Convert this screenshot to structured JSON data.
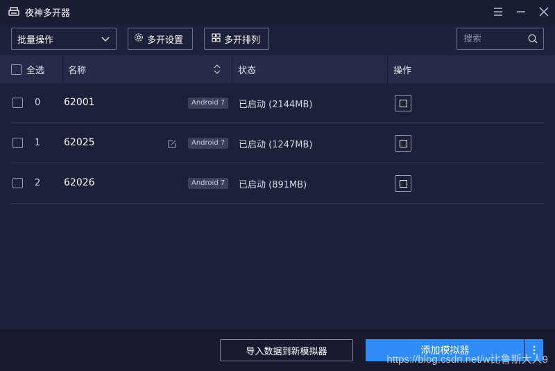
{
  "window": {
    "title": "夜神多开器",
    "app_icon": "printer-icon",
    "controls": [
      "menu-icon",
      "minimize-icon",
      "close-icon"
    ]
  },
  "toolbar": {
    "batch_select": {
      "value": "批量操作",
      "icon": "chevron-down-icon"
    },
    "settings_label": "多开设置",
    "settings_icon": "gear-icon",
    "arrange_label": "多开排列",
    "arrange_icon": "grid-icon",
    "search_placeholder": "搜索",
    "search_icon": "search-icon"
  },
  "table": {
    "headers": {
      "select_all": "全选",
      "name": "名称",
      "status": "状态",
      "actions": "操作"
    },
    "rows": [
      {
        "index": "0",
        "name": "62001",
        "badge": "Android 7",
        "status": "已启动 (2144MB)",
        "editable": false
      },
      {
        "index": "1",
        "name": "62025",
        "badge": "Android 7",
        "status": "已启动 (1247MB)",
        "editable": true
      },
      {
        "index": "2",
        "name": "62026",
        "badge": "Android 7",
        "status": "已启动 (891MB)",
        "editable": false
      }
    ]
  },
  "footer": {
    "import_label": "导入数据到新模拟器",
    "add_label": "添加模拟器",
    "more_icon": "more-vertical-icon"
  },
  "watermark": "https://blog.csdn.net/w比鲁斯大人9",
  "colors": {
    "background": "#1c2038",
    "header_bg": "#262b47",
    "accent": "#2f8bf5"
  }
}
